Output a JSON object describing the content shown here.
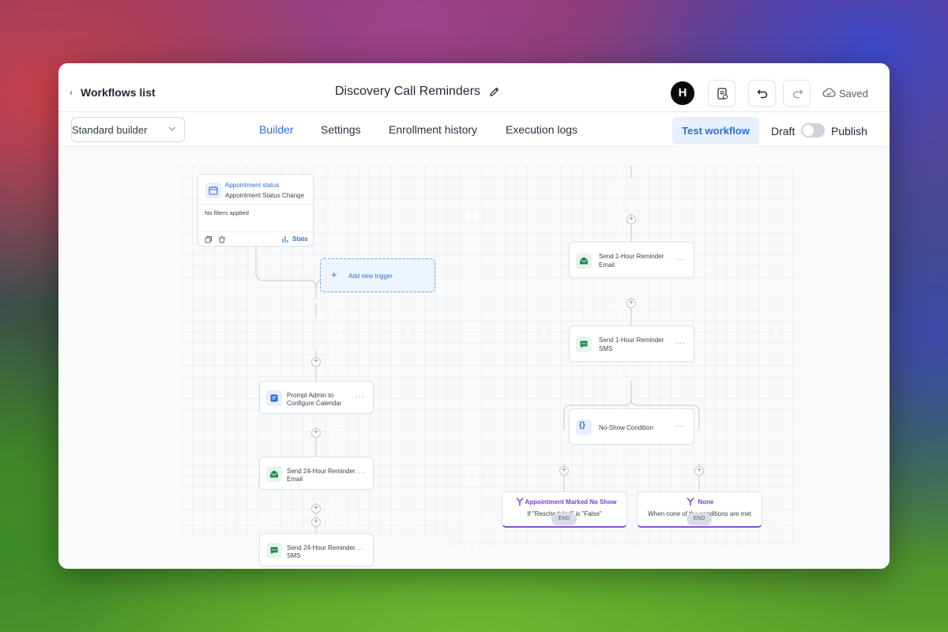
{
  "header": {
    "workflows_list": "Workflows list",
    "workflow_title": "Discovery Call Reminders",
    "avatar_letter": "H",
    "saved": "Saved"
  },
  "toolbar": {
    "builder_select": "Standard builder",
    "tabs": [
      "Builder",
      "Settings",
      "Enrollment history",
      "Execution logs"
    ],
    "test_workflow": "Test workflow",
    "draft": "Draft",
    "publish": "Publish"
  },
  "trigger": {
    "title": "Appointment status",
    "subtitle": "Appointment Status Change",
    "filters": "No filters applied",
    "stats": "Stats",
    "add_trigger": "Add new trigger"
  },
  "left_nodes": [
    {
      "line1": "Prompt Admin to",
      "line2": "Configure Calendar"
    },
    {
      "line1": "Send 24-Hour Reminder",
      "line2": "Email"
    },
    {
      "line1": "Send 24-Hour Reminder",
      "line2": "SMS"
    }
  ],
  "right_nodes": [
    {
      "line1": "Send 1-Hour Reminder",
      "line2": "Email"
    },
    {
      "line1": "Send 1-Hour Reminder",
      "line2": "SMS"
    },
    {
      "line1": "No-Show Condition",
      "line2": ""
    }
  ],
  "branches": [
    {
      "title": "Appointment Marked No Show",
      "subtitle": "If \"Rescheduled\" is \"False\""
    },
    {
      "title": "None",
      "subtitle": "When none of the conditions are met"
    }
  ],
  "end_label": "END",
  "colors": {
    "accent": "#2f6fd1",
    "branch": "#8a4fd8",
    "email_icon": "#1f8a4c"
  }
}
